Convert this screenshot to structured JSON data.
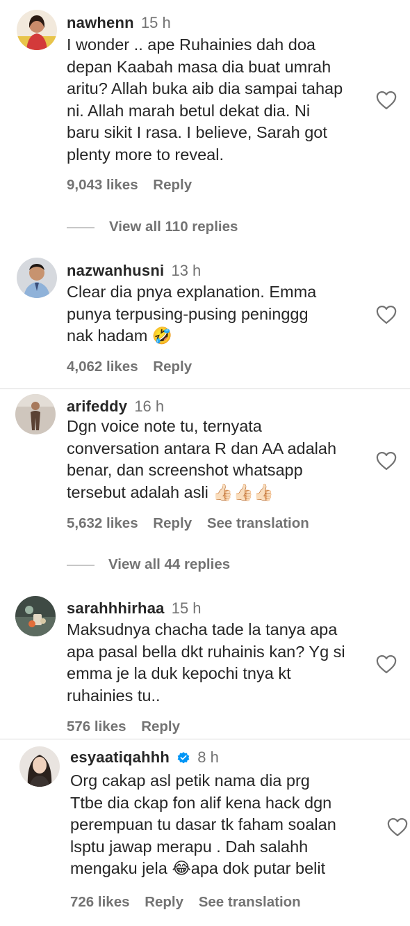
{
  "comments": [
    {
      "username": "nawhenn",
      "time": "15 h",
      "lines": [
        "I wonder .. ape Ruhainies dah doa",
        "depan Kaabah masa dia buat umrah",
        "aritu? Allah buka aib dia sampai tahap",
        "ni. Allah marah betul dekat dia. Ni",
        "baru sikit I rasa. I believe, Sarah got",
        "plenty more to reveal."
      ],
      "likes": "9,043 likes",
      "reply": "Reply",
      "view_replies": "View all 110 replies"
    },
    {
      "username": "nazwanhusni",
      "time": "13 h",
      "lines": [
        "Clear dia pnya explanation. Emma",
        "punya terpusing-pusing peninggg",
        "nak hadam 🤣"
      ],
      "likes": "4,062 likes",
      "reply": "Reply"
    },
    {
      "username": "arifeddy",
      "time": "16 h",
      "lines": [
        "Dgn voice note tu, ternyata",
        "conversation antara R dan AA adalah",
        "benar, dan screenshot whatsapp",
        "tersebut adalah asli 👍🏻👍🏻👍🏻"
      ],
      "likes": "5,632 likes",
      "reply": "Reply",
      "see_translation": "See translation",
      "view_replies": "View all 44 replies"
    },
    {
      "username": "sarahhhirhaa",
      "time": "15 h",
      "lines": [
        "Maksudnya chacha tade la tanya apa",
        "apa pasal bella dkt ruhainis kan? Yg si",
        "emma je la duk kepochi tnya kt",
        "ruhainies tu.."
      ],
      "likes": "576 likes",
      "reply": "Reply"
    },
    {
      "username": "esyaatiqahhh",
      "time": "8 h",
      "verified": true,
      "lines": [
        "Org cakap asl petik nama dia prg",
        "Ttbe dia ckap fon alif kena hack dgn",
        "perempuan tu dasar tk faham soalan",
        "lsptu jawap merapu . Dah salahh",
        "mengaku jela 😂apa dok putar belit"
      ],
      "likes": "726 likes",
      "reply": "Reply",
      "see_translation": "See translation"
    }
  ],
  "colors": {
    "text": "#262626",
    "secondary": "#737373",
    "verified": "#0095f6",
    "divider": "#dbdbdb"
  },
  "icons": [
    "heart-outline-icon",
    "verified-badge-icon"
  ]
}
